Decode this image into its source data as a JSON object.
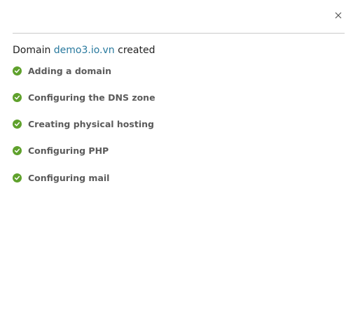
{
  "dialog": {
    "heading_prefix": "Domain",
    "domain_name": "demo3.io.vn",
    "heading_suffix": "created",
    "close_icon": "close-icon"
  },
  "colors": {
    "link": "#28799e",
    "success": "#5fa12c",
    "divider": "#c9c9c9"
  },
  "steps": [
    {
      "label": "Adding a domain",
      "status": "done",
      "icon": "check-circle-icon"
    },
    {
      "label": "Configuring the DNS zone",
      "status": "done",
      "icon": "check-circle-icon"
    },
    {
      "label": "Creating physical hosting",
      "status": "done",
      "icon": "check-circle-icon"
    },
    {
      "label": "Configuring PHP",
      "status": "done",
      "icon": "check-circle-icon"
    },
    {
      "label": "Configuring mail",
      "status": "done",
      "icon": "check-circle-icon"
    }
  ]
}
